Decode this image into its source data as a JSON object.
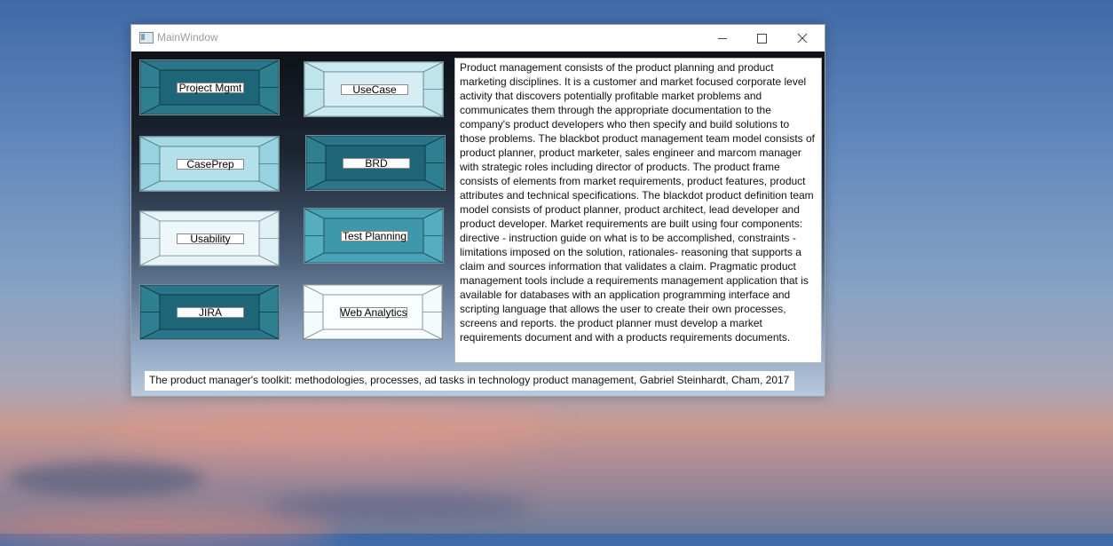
{
  "window": {
    "title": "MainWindow"
  },
  "tiles": [
    {
      "label": "Project Mgmt",
      "style": "dark"
    },
    {
      "label": "UseCase",
      "style": "light"
    },
    {
      "label": "CasePrep",
      "style": "medium"
    },
    {
      "label": "BRD",
      "style": "dark"
    },
    {
      "label": "Usability",
      "style": "pale"
    },
    {
      "label": "Test Planning",
      "style": "medium-dark"
    },
    {
      "label": "JIRA",
      "style": "dark"
    },
    {
      "label": "Web Analytics",
      "style": "white"
    }
  ],
  "description": "Product management consists of the product planning and product marketing disciplines. It is a customer and market focused corporate level activity that discovers potentially profitable market problems and communicates them through the appropriate documentation to the company's product developers who then specify and build solutions to those problems.  The blackbot product management team model consists of  product planner, product marketer, sales engineer and marcom manager with strategic roles including director of products. The product frame consists of elements from market requirements, product features, product attributes and technical specifications.  The blackdot product definition team model consists of product planner, product architect, lead developer and product developer. Market requirements are built using four components: directive - instruction guide on what is to be accomplished, constraints - limitations imposed on the solution, rationales- reasoning that supports a claim and sources information that validates a claim. Pragmatic product management tools include a requirements management application that is available for databases with an application programming interface and scripting language that allows the user to create their own processes, screens and reports.  the product planner must develop a market requirements document and with a products requirements documents.",
  "citation": "The product manager's toolkit: methodologies, processes, ad tasks in technology product management, Gabriel Steinhardt, Cham, 2017",
  "colors": {
    "dark_outer": "#2e7f90",
    "dark_inner": "#1f6a7c",
    "light_outer": "#c3e6ee",
    "light_inner": "#a9dbe6",
    "pale_outer": "#e4f3f6",
    "white_outer": "#f6fbfc"
  }
}
